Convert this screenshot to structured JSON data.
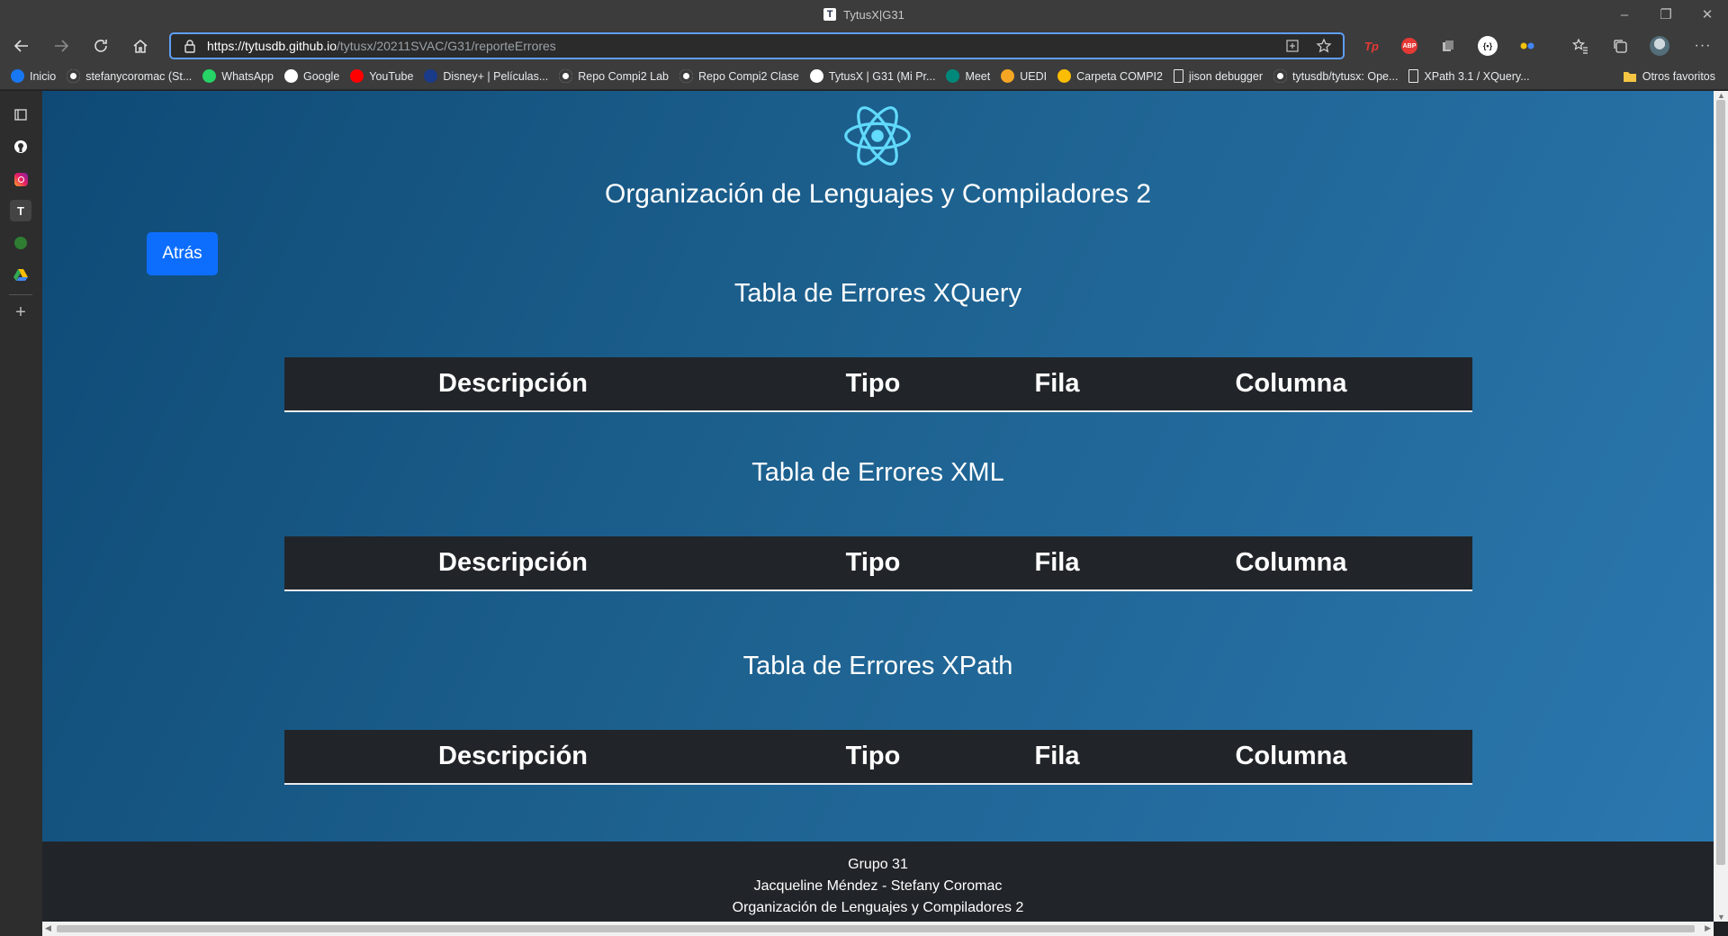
{
  "window": {
    "title": "TytusX|G31",
    "tab_icon_letter": "T"
  },
  "toolbar": {
    "url_host": "https://tytusdb.github.io",
    "url_path": "/tytusx/20211SVAC/G31/reporteErrores"
  },
  "extensions": {
    "tp_label": "Tp",
    "abp_label": "ABP"
  },
  "bookmarks": {
    "items": [
      {
        "label": "Inicio",
        "icon": "facebook-icon",
        "color": "#1877f2"
      },
      {
        "label": "stefanycoromac (St...",
        "icon": "github-icon",
        "color": "#ffffff"
      },
      {
        "label": "WhatsApp",
        "icon": "whatsapp-icon",
        "color": "#25d366"
      },
      {
        "label": "Google",
        "icon": "google-icon",
        "color": "#ffffff"
      },
      {
        "label": "YouTube",
        "icon": "youtube-icon",
        "color": "#ff0000"
      },
      {
        "label": "Disney+ | Películas...",
        "icon": "disney-icon",
        "color": "#1a3a8a"
      },
      {
        "label": "Repo Compi2 Lab",
        "icon": "github-icon",
        "color": "#ffffff"
      },
      {
        "label": "Repo Compi2 Clase",
        "icon": "github-icon",
        "color": "#ffffff"
      },
      {
        "label": "TytusX | G31 (Mi Pr...",
        "icon": "tytus-icon",
        "color": "#ffffff"
      },
      {
        "label": "Meet",
        "icon": "meet-icon",
        "color": "#00897b"
      },
      {
        "label": "UEDI",
        "icon": "uedi-icon",
        "color": "#f5a623"
      },
      {
        "label": "Carpeta COMPI2",
        "icon": "drive-icon",
        "color": "#fbbc04"
      },
      {
        "label": "jison debugger",
        "icon": "page-icon",
        "color": "#e8eaed"
      },
      {
        "label": "tytusdb/tytusx: Ope...",
        "icon": "github-icon",
        "color": "#ffffff"
      },
      {
        "label": "XPath 3.1 / XQuery...",
        "icon": "page-icon",
        "color": "#e8eaed"
      }
    ],
    "other_label": "Otros favoritos"
  },
  "page": {
    "site_title": "Organización de Lenguajes y Compiladores 2",
    "back_label": "Atrás",
    "tables": [
      {
        "title": "Tabla de Errores XQuery",
        "headers": [
          "Descripción",
          "Tipo",
          "Fila",
          "Columna"
        ]
      },
      {
        "title": "Tabla de Errores XML",
        "headers": [
          "Descripción",
          "Tipo",
          "Fila",
          "Columna"
        ]
      },
      {
        "title": "Tabla de Errores XPath",
        "headers": [
          "Descripción",
          "Tipo",
          "Fila",
          "Columna"
        ]
      }
    ]
  },
  "footer": {
    "line1": "Grupo 31",
    "line2": "Jacqueline Méndez - Stefany Coromac",
    "line3": "Organización de Lenguajes y Compiladores 2"
  },
  "colors": {
    "accent": "#0d6efd",
    "table_head": "#212529",
    "react_logo": "#61dafb"
  }
}
